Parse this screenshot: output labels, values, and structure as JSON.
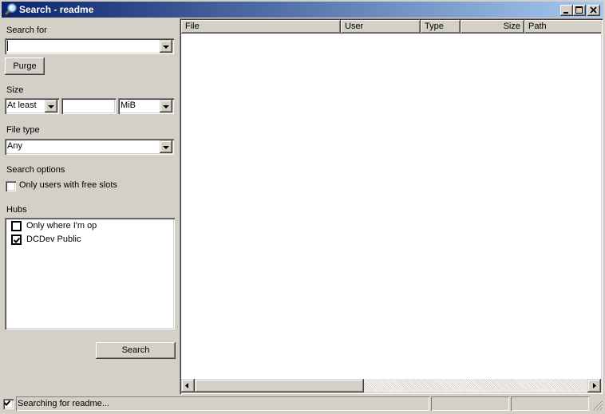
{
  "window": {
    "title": "Search - readme",
    "icon": "magnifier-icon",
    "controls": [
      "minimize",
      "maximize",
      "close"
    ]
  },
  "search_panel": {
    "search_for_label": "Search for",
    "search_for_value": "",
    "purge_label": "Purge",
    "size_label": "Size",
    "size_mode": "At least",
    "size_value": "",
    "size_unit": "MiB",
    "file_type_label": "File type",
    "file_type_value": "Any",
    "search_options_label": "Search options",
    "free_slots_label": "Only users with free slots",
    "free_slots_checked": false,
    "hubs_label": "Hubs",
    "hubs": [
      {
        "label": "Only where I'm op",
        "checked": false
      },
      {
        "label": "DCDev Public",
        "checked": true
      }
    ],
    "search_button_label": "Search"
  },
  "results": {
    "columns": [
      "File",
      "User",
      "Type",
      "Size",
      "Path"
    ],
    "rows": []
  },
  "statusbar": {
    "checkbox_checked": true,
    "status_text": "Searching for readme...",
    "panel2": "",
    "panel3": ""
  }
}
